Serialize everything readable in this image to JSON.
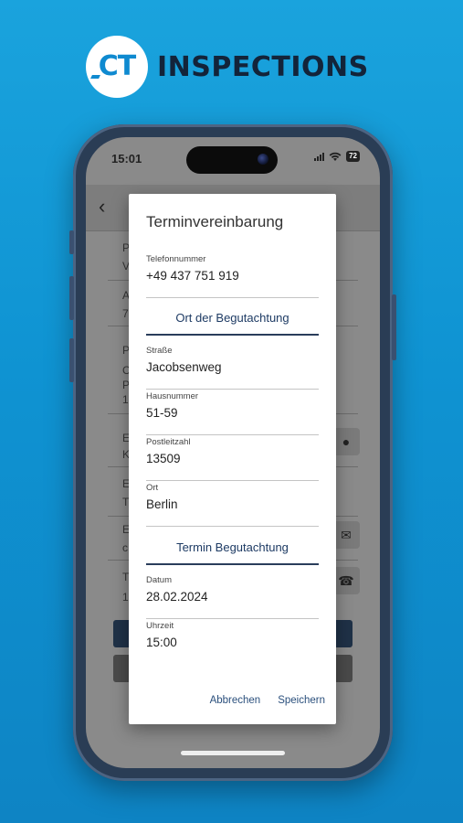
{
  "brand": {
    "mark": "CT",
    "name": "INSPECTIONS"
  },
  "status": {
    "time": "15:01",
    "battery": "72"
  },
  "background_app": {
    "back_icon": "chevron-left-icon",
    "partial_chars": [
      "P",
      "V",
      "A",
      "7",
      "P",
      "C",
      "P",
      "1",
      "E",
      "K",
      "E",
      "T",
      "E",
      "c",
      "T",
      "1"
    ],
    "side_icons": [
      "map-pin-icon",
      "mail-icon",
      "phone-icon"
    ]
  },
  "dialog": {
    "title": "Terminvereinbarung",
    "phone": {
      "label": "Telefonnummer",
      "value": "+49 437 751 919"
    },
    "section_location": "Ort der Begutachtung",
    "street": {
      "label": "Straße",
      "value": "Jacobsenweg"
    },
    "house_number": {
      "label": "Hausnummer",
      "value": "51-59"
    },
    "postal_code": {
      "label": "Postleitzahl",
      "value": "13509"
    },
    "city": {
      "label": "Ort",
      "value": "Berlin"
    },
    "section_appointment": "Termin Begutachtung",
    "date": {
      "label": "Datum",
      "value": "28.02.2024"
    },
    "time": {
      "label": "Uhrzeit",
      "value": "15:00"
    },
    "cancel_label": "Abbrechen",
    "save_label": "Speichern"
  }
}
